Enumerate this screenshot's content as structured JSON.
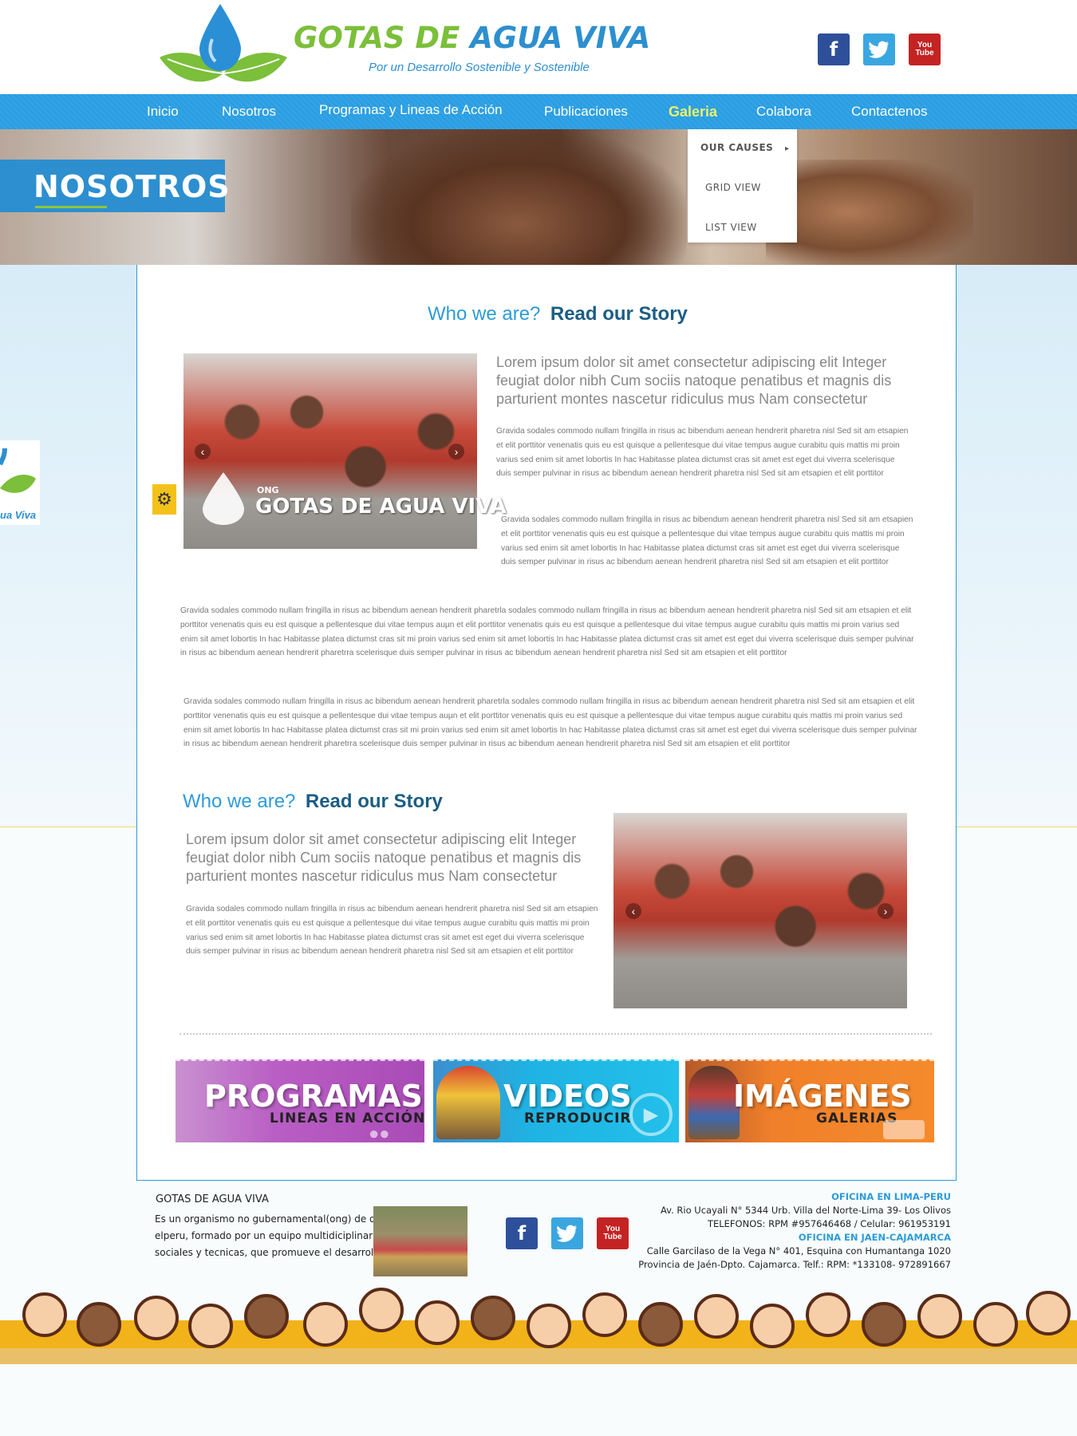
{
  "brand": {
    "title_part1": "GOTAS DE",
    "title_part2": "AGUA VIVA",
    "tagline": "Por un Desarrollo Sostenible y Sostenible"
  },
  "social": [
    "facebook-icon",
    "twitter-icon",
    "youtube-icon"
  ],
  "social_labels": {
    "facebook": "f",
    "youtube": "You Tube"
  },
  "nav": {
    "items": [
      {
        "label": "Inicio"
      },
      {
        "label": "Nosotros"
      },
      {
        "label": "Programas y Lineas de Acción"
      },
      {
        "label": "Publicaciones"
      },
      {
        "label": "Galeria"
      },
      {
        "label": "Colabora"
      },
      {
        "label": "Contactenos"
      }
    ],
    "active": "Galeria"
  },
  "dropdown": {
    "items": [
      "OUR CAUSES",
      "GRID VIEW",
      "LIST VIEW"
    ],
    "caret": "▸"
  },
  "hero": {
    "title": "NOSOTROS"
  },
  "side_logo": {
    "text": "ua Viva"
  },
  "section1": {
    "heading_light": "Who we are?",
    "heading_bold": "Read our Story",
    "image_label_small": "ONG",
    "image_label": "GOTAS DE AGUA VIVA",
    "lead": "Lorem ipsum dolor sit amet consectetur adipiscing elit Integer feugiat dolor nibh Cum sociis natoque penatibus et magnis dis parturient montes nascetur ridiculus mus Nam consectetur",
    "para_a": "Gravida sodales commodo nullam fringilla in risus ac bibendum aenean hendrerit pharetra nisl Sed sit am etsapien et elit porttitor venenatis quis eu est quisque a pellentesque dui vitae tempus augue curabitu quis mattis mi proin varius sed enim sit amet lobortis In hac Habitasse platea dictumst cras sit amet est eget dui viverra scelerisque duis semper pulvinar in risus ac bibendum aenean hendrerit pharetra nisl Sed sit am etsapien et elit porttitor",
    "para_b": "Gravida sodales commodo nullam fringilla in risus ac bibendum aenean hendrerit pharetra nisl Sed sit am etsapien et elit porttitor venenatis quis eu est quisque a pellentesque dui vitae tempus augue curabitu quis mattis mi proin varius sed enim sit amet lobortis In hac Habitasse platea dictumst cras sit amet est eget dui viverra scelerisque duis semper pulvinar in risus ac bibendum aenean hendrerit pharetra nisl Sed sit am etsapien et elit porttitor",
    "para_c": "Gravida sodales commodo nullam fringilla in risus ac bibendum aenean hendrerit pharetrla sodales commodo nullam fringilla in risus ac bibendum aenean hendrerit pharetra nisl Sed sit am etsapien et elit porttitor venenatis quis eu est quisque a pellentesque dui vitae tempus auµn et elit porttitor venenatis quis eu est quisque a pellentesque dui vitae tempus augue curabitu quis mattis mi proin varius sed enim sit amet lobortis In hac Habitasse platea dictumst cras sit mi proin varius sed enim sit amet lobortis In hac Habitasse platea dictumst cras sit amet est eget dui viverra scelerisque duis semper pulvinar in risus ac bibendum aenean hendrerit pharetrra scelerisque duis semper pulvinar in risus ac bibendum aenean hendrerit pharetra nisl Sed sit am etsapien et elit porttitor",
    "para_d": "Gravida sodales commodo nullam fringilla in risus ac bibendum aenean hendrerit pharetrla sodales commodo nullam fringilla in risus ac bibendum aenean hendrerit pharetra nisl Sed sit am etsapien et elit porttitor venenatis quis eu est quisque a pellentesque dui vitae tempus auµn et elit porttitor venenatis quis eu est quisque a pellentesque dui vitae tempus augue curabitu quis mattis mi proin varius sed enim sit amet lobortis In hac Habitasse platea dictumst cras sit mi proin varius sed enim sit amet lobortis In hac Habitasse platea dictumst cras sit amet est eget dui viverra scelerisque duis semper pulvinar in risus ac bibendum aenean hendrerit pharetrra scelerisque duis semper pulvinar in risus ac bibendum aenean hendrerit pharetra nisl Sed sit am etsapien et elit porttitor"
  },
  "section2": {
    "heading_light": "Who we are?",
    "heading_bold": "Read our Story",
    "lead": "Lorem ipsum dolor sit amet consectetur adipiscing elit Integer feugiat dolor nibh Cum sociis natoque penatibus et magnis dis parturient montes nascetur ridiculus mus Nam consectetur",
    "para": "Gravida sodales commodo nullam fringilla in risus ac bibendum aenean hendrerit pharetra nisl Sed sit am etsapien et elit porttitor venenatis quis eu est quisque a pellentesque dui vitae tempus augue curabitu quis mattis mi proin varius sed enim sit amet lobortis In hac Habitasse platea dictumst cras sit amet est eget dui viverra scelerisque duis semper pulvinar in risus ac bibendum aenean hendrerit pharetra nisl Sed sit am etsapien et elit porttitor"
  },
  "banners": [
    {
      "big": "PROGRAMAS",
      "small": "LINEAS EN ACCIÓN",
      "color": "#b95ec4"
    },
    {
      "big": "VIDEOS",
      "small": "REPRODUCIR",
      "color": "#1fb3e3"
    },
    {
      "big": "IMÁGENES",
      "small": "GALERIAS",
      "color": "#f0802a"
    }
  ],
  "footer": {
    "title": "GOTAS DE AGUA VIVA",
    "desc_lines": [
      "Es un organismo no gubernamental(ong) de desa",
      "elperu, formado por un equipo multidiciplinario de",
      "sociales y tecnicas, que promueve el desarrollo."
    ],
    "lima_title": "OFICINA EN LIMA-PERU",
    "lima_address": "Av. Rio Ucayali N° 5344 Urb. Villa del Norte-Lima 39- Los Olivos",
    "lima_phones": "TELEFONOS: RPM #957646468 / Celular: 961953191",
    "jaen_title": "OFICINA EN JAEN-CAJAMARCA",
    "jaen_address": "Calle Garcilaso de la Vega N° 401, Esquina con Humantanga 1020",
    "jaen_phones": "Provincia de Jaén-Dpto. Cajamarca. Telf.: RPM: *133108- 972891667"
  },
  "colors": {
    "accent": "#2a9ee3",
    "brand_green": "#7bbf3a",
    "nav_active": "#e8f26a"
  }
}
